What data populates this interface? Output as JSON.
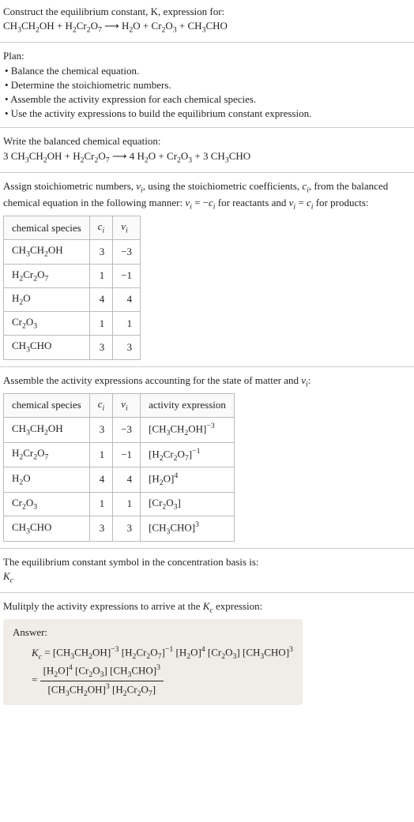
{
  "header": {
    "line1": "Construct the equilibrium constant, K, expression for:",
    "equation_html": "CH<sub>3</sub>CH<sub>2</sub>OH + H<sub>2</sub>Cr<sub>2</sub>O<sub>7</sub> ⟶ H<sub>2</sub>O + Cr<sub>2</sub>O<sub>3</sub> + CH<sub>3</sub>CHO"
  },
  "plan": {
    "title": "Plan:",
    "items": [
      "• Balance the chemical equation.",
      "• Determine the stoichiometric numbers.",
      "• Assemble the activity expression for each chemical species.",
      "• Use the activity expressions to build the equilibrium constant expression."
    ]
  },
  "balanced": {
    "title": "Write the balanced chemical equation:",
    "equation_html": "3 CH<sub>3</sub>CH<sub>2</sub>OH + H<sub>2</sub>Cr<sub>2</sub>O<sub>7</sub> ⟶ 4 H<sub>2</sub>O + Cr<sub>2</sub>O<sub>3</sub> + 3 CH<sub>3</sub>CHO"
  },
  "stoich": {
    "intro_html": "Assign stoichiometric numbers, <span class=\"ital\">ν<sub>i</sub></span>, using the stoichiometric coefficients, <span class=\"ital\">c<sub>i</sub></span>, from the balanced chemical equation in the following manner: <span class=\"ital\">ν<sub>i</sub></span> = −<span class=\"ital\">c<sub>i</sub></span> for reactants and <span class=\"ital\">ν<sub>i</sub></span> = <span class=\"ital\">c<sub>i</sub></span> for products:",
    "headers": {
      "species": "chemical species",
      "ci_html": "<span class=\"ital\">c<sub>i</sub></span>",
      "vi_html": "<span class=\"ital\">ν<sub>i</sub></span>"
    },
    "rows": [
      {
        "species_html": "CH<sub>3</sub>CH<sub>2</sub>OH",
        "ci": "3",
        "vi": "−3"
      },
      {
        "species_html": "H<sub>2</sub>Cr<sub>2</sub>O<sub>7</sub>",
        "ci": "1",
        "vi": "−1"
      },
      {
        "species_html": "H<sub>2</sub>O",
        "ci": "4",
        "vi": "4"
      },
      {
        "species_html": "Cr<sub>2</sub>O<sub>3</sub>",
        "ci": "1",
        "vi": "1"
      },
      {
        "species_html": "CH<sub>3</sub>CHO",
        "ci": "3",
        "vi": "3"
      }
    ]
  },
  "activity": {
    "intro_html": "Assemble the activity expressions accounting for the state of matter and <span class=\"ital\">ν<sub>i</sub></span>:",
    "headers": {
      "species": "chemical species",
      "ci_html": "<span class=\"ital\">c<sub>i</sub></span>",
      "vi_html": "<span class=\"ital\">ν<sub>i</sub></span>",
      "activity": "activity expression"
    },
    "rows": [
      {
        "species_html": "CH<sub>3</sub>CH<sub>2</sub>OH",
        "ci": "3",
        "vi": "−3",
        "activity_html": "[CH<sub>3</sub>CH<sub>2</sub>OH]<sup>−3</sup>"
      },
      {
        "species_html": "H<sub>2</sub>Cr<sub>2</sub>O<sub>7</sub>",
        "ci": "1",
        "vi": "−1",
        "activity_html": "[H<sub>2</sub>Cr<sub>2</sub>O<sub>7</sub>]<sup>−1</sup>"
      },
      {
        "species_html": "H<sub>2</sub>O",
        "ci": "4",
        "vi": "4",
        "activity_html": "[H<sub>2</sub>O]<sup>4</sup>"
      },
      {
        "species_html": "Cr<sub>2</sub>O<sub>3</sub>",
        "ci": "1",
        "vi": "1",
        "activity_html": "[Cr<sub>2</sub>O<sub>3</sub>]"
      },
      {
        "species_html": "CH<sub>3</sub>CHO",
        "ci": "3",
        "vi": "3",
        "activity_html": "[CH<sub>3</sub>CHO]<sup>3</sup>"
      }
    ]
  },
  "symbol": {
    "line1": "The equilibrium constant symbol in the concentration basis is:",
    "line2_html": "<span class=\"ital\">K<sub>c</sub></span>"
  },
  "multiply": {
    "intro_html": "Mulitply the activity expressions to arrive at the <span class=\"ital\">K<sub>c</sub></span> expression:"
  },
  "answer": {
    "label": "Answer:",
    "line1_html": "<span class=\"ital\">K<sub>c</sub></span> = [CH<sub>3</sub>CH<sub>2</sub>OH]<sup>−3</sup> [H<sub>2</sub>Cr<sub>2</sub>O<sub>7</sub>]<sup>−1</sup> [H<sub>2</sub>O]<sup>4</sup> [Cr<sub>2</sub>O<sub>3</sub>] [CH<sub>3</sub>CHO]<sup>3</sup>",
    "frac_num_html": "[H<sub>2</sub>O]<sup>4</sup> [Cr<sub>2</sub>O<sub>3</sub>] [CH<sub>3</sub>CHO]<sup>3</sup>",
    "frac_den_html": "[CH<sub>3</sub>CH<sub>2</sub>OH]<sup>3</sup> [H<sub>2</sub>Cr<sub>2</sub>O<sub>7</sub>]",
    "equals": "= "
  }
}
